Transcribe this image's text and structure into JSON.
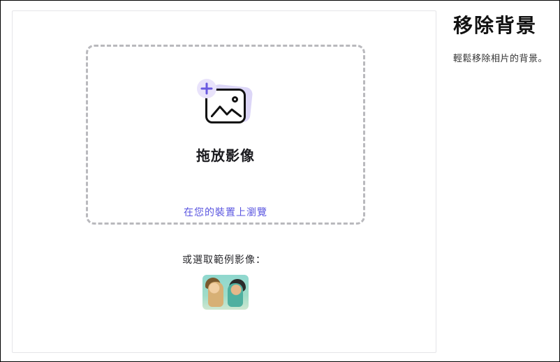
{
  "right": {
    "title": "移除背景",
    "description": "輕鬆移除相片的背景。"
  },
  "dropzone": {
    "title": "拖放影像",
    "browse_link": "在您的裝置上瀏覽",
    "icon_name": "image-placeholder-icon",
    "plus_icon_name": "plus-icon",
    "plus_color": "#6a5ae0"
  },
  "samples": {
    "label": "或選取範例影像：",
    "items": [
      {
        "alt": "sample-selfie-two-people"
      }
    ]
  }
}
